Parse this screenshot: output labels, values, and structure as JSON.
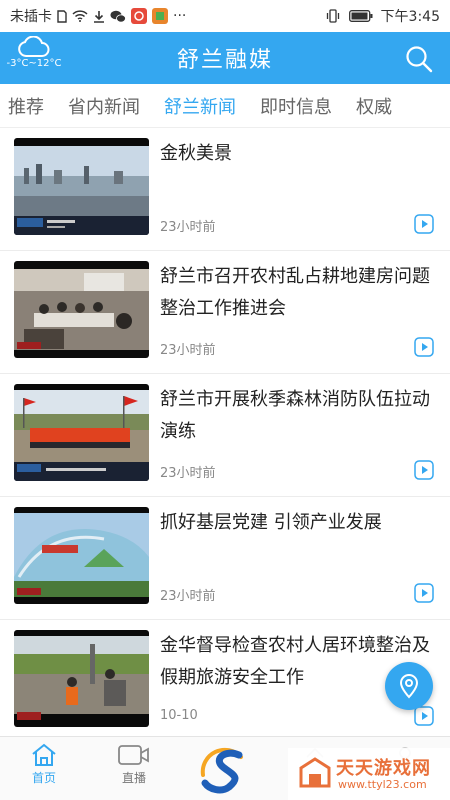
{
  "status_bar": {
    "carrier": "未插卡",
    "time": "下午3:45",
    "icons": [
      "sim-card-icon",
      "wifi-icon",
      "download-icon",
      "wechat-icon",
      "app-badge-icon",
      "app-badge-icon",
      "more-icon",
      "vibrate-icon",
      "battery-icon"
    ],
    "more": "···"
  },
  "header": {
    "title": "舒兰融媒",
    "weather": "-3°C~12°C",
    "accent": "#34a7f0"
  },
  "tabs": [
    {
      "label": "推荐",
      "active": false
    },
    {
      "label": "省内新闻",
      "active": false
    },
    {
      "label": "舒兰新闻",
      "active": true
    },
    {
      "label": "即时信息",
      "active": false
    },
    {
      "label": "权威",
      "active": false
    }
  ],
  "news": [
    {
      "title": "金秋美景",
      "time": "23小时前",
      "thumb_icon": "autumn-scene-thumbnail"
    },
    {
      "title": "舒兰市召开农村乱占耕地建房问题整治工作推进会",
      "time": "23小时前",
      "thumb_icon": "meeting-room-thumbnail"
    },
    {
      "title": "舒兰市开展秋季森林消防队伍拉动演练",
      "time": "23小时前",
      "thumb_icon": "firefighters-drill-thumbnail"
    },
    {
      "title": "抓好基层党建 引领产业发展",
      "time": "23小时前",
      "thumb_icon": "greenhouse-thumbnail"
    },
    {
      "title": "金华督导检查农村人居环境整治及假期旅游安全工作",
      "time": "10-10",
      "thumb_icon": "inspection-thumbnail"
    }
  ],
  "bottom_nav": {
    "home": "首页",
    "live": "直播"
  },
  "watermark": {
    "text": "天天游戏网",
    "url": "www.ttyl23.com"
  }
}
